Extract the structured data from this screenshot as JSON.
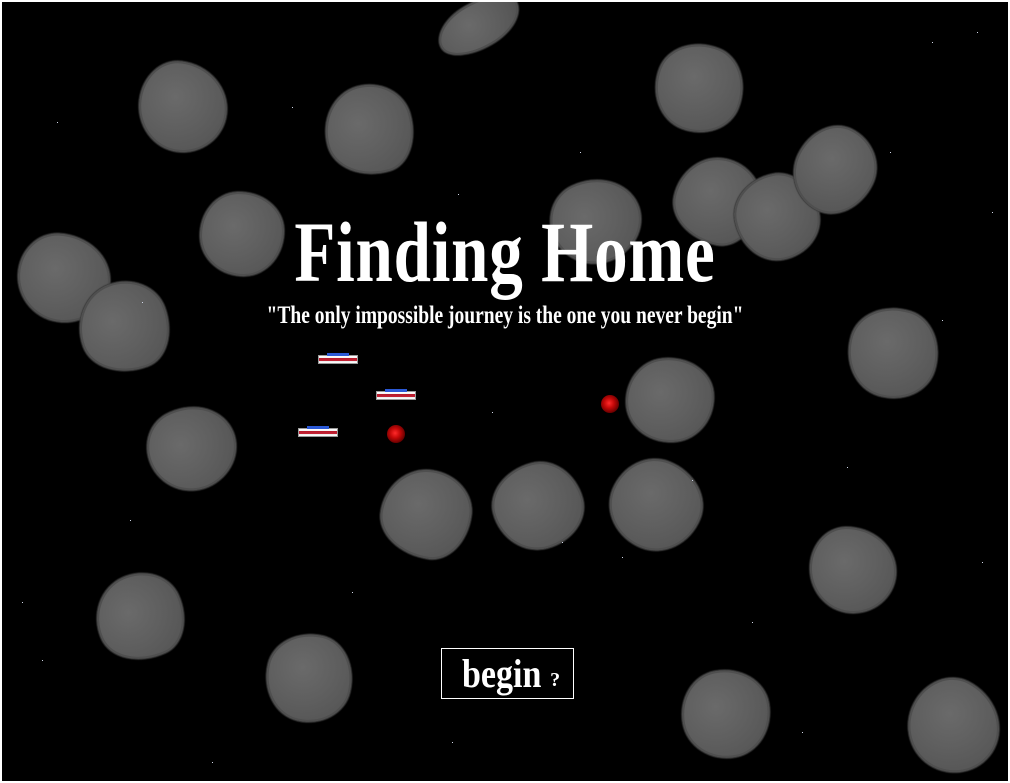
{
  "game": {
    "title": "Finding Home",
    "tagline": "\"The only impossible journey is the one you never begin\"",
    "start_button": {
      "label": "begin",
      "mark": "?"
    }
  },
  "colors": {
    "background": "#000000",
    "asteroid": "#5f5f5f",
    "text": "#ffffff",
    "mine": "#c40808",
    "ship_stripe_red": "#c42235",
    "ship_stripe_blue": "#2b59d6"
  }
}
